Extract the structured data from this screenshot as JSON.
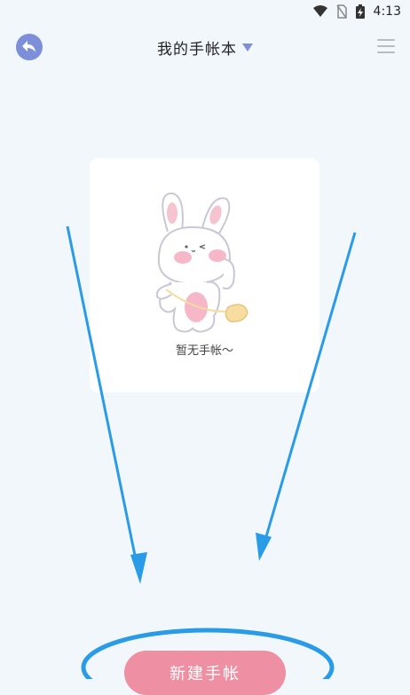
{
  "status_bar": {
    "time": "4:13"
  },
  "header": {
    "title": "我的手帐本"
  },
  "empty_state": {
    "message": "暂无手帐～"
  },
  "actions": {
    "new_label": "新建手帐"
  },
  "colors": {
    "background": "#f2f7fb",
    "accent": "#7e8fd9",
    "button": "#ef8fa3",
    "arrow": "#2a9be6"
  }
}
